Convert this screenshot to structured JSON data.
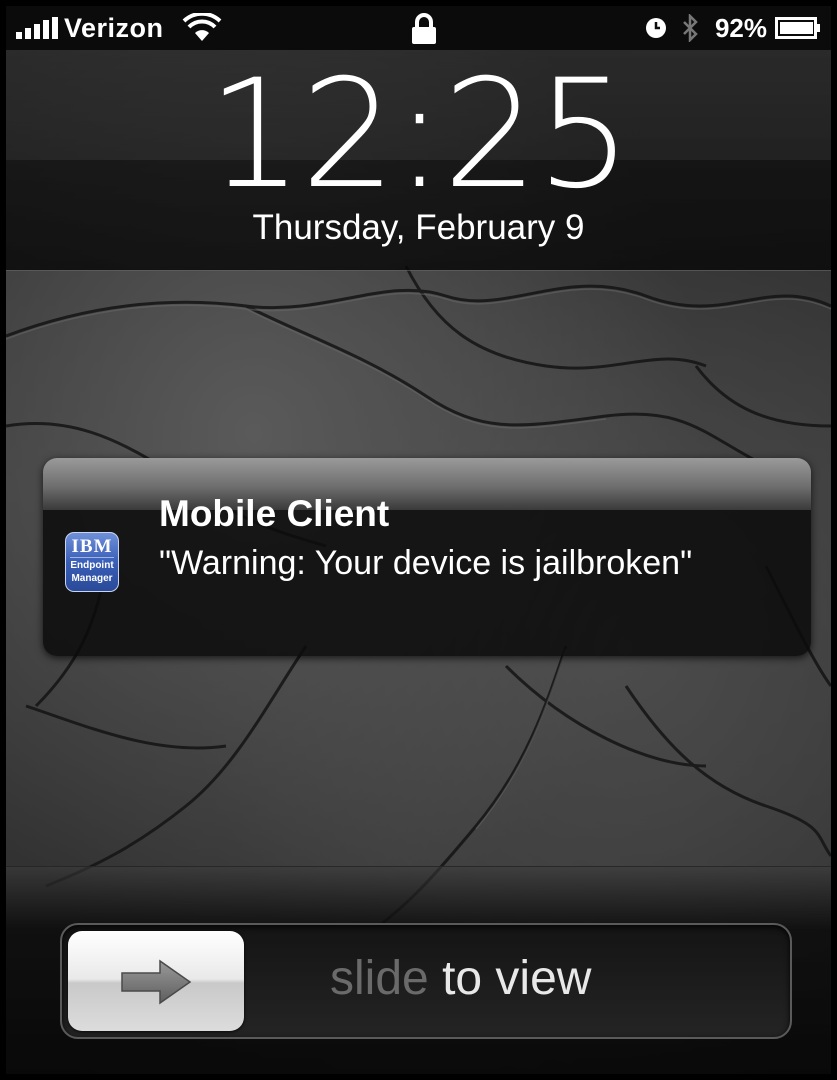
{
  "status_bar": {
    "carrier": "Verizon",
    "battery_percent": "92%",
    "icons": [
      "signal-icon",
      "wifi-icon",
      "lock-icon",
      "alarm-clock-icon",
      "bluetooth-icon",
      "battery-icon"
    ]
  },
  "lock_screen": {
    "time": "12:25",
    "date": "Thursday, February 9"
  },
  "notification": {
    "app_name": "Mobile Client",
    "message": "\"Warning: Your device is jailbroken\"",
    "icon": {
      "brand": "IBM",
      "caption_line1": "Endpoint",
      "caption_line2": "Manager"
    }
  },
  "slider": {
    "label_dim": "slide ",
    "label_lit": "to view",
    "knob_icon": "right-arrow-icon"
  }
}
